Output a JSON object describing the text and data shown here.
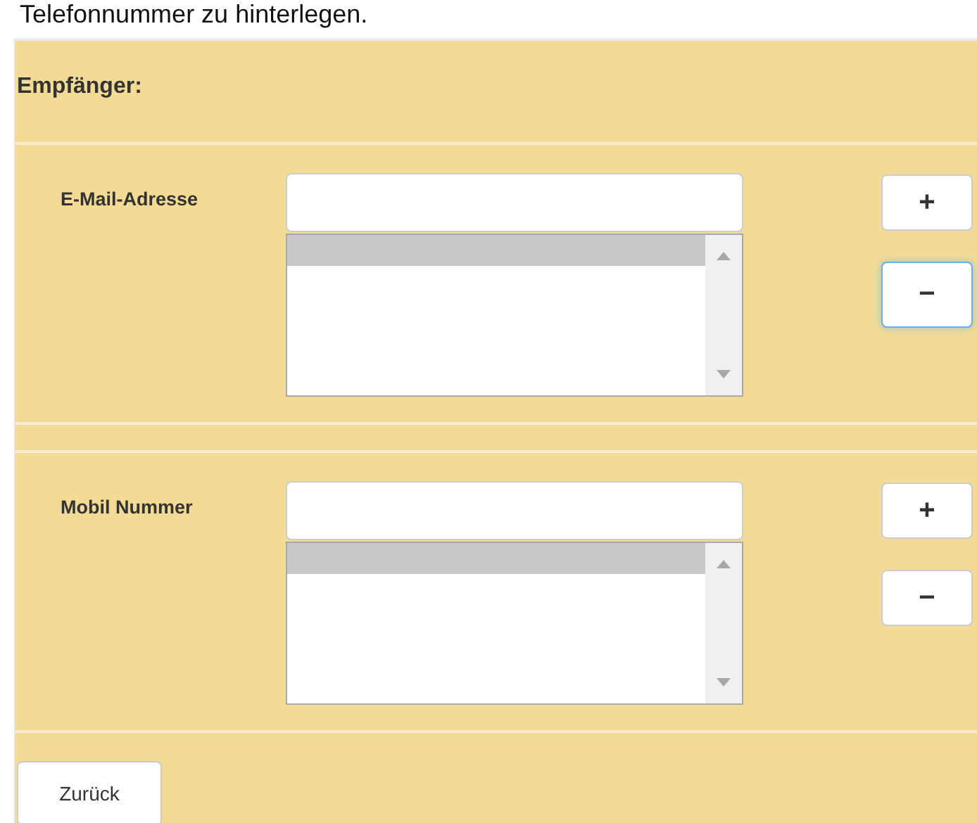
{
  "intro_text": "Telefonnummer zu hinterlegen.",
  "heading": "Empfänger:",
  "sections": [
    {
      "label": "E-Mail-Adresse",
      "list_entries": [
        {
          "selected": true
        }
      ],
      "buttons": [
        {
          "symbol": "+",
          "focused": false
        },
        {
          "symbol": "−",
          "focused": true
        }
      ]
    },
    {
      "label": "Mobil Nummer",
      "list_entries": [
        {
          "selected": true
        }
      ],
      "buttons": [
        {
          "symbol": "+",
          "focused": false
        },
        {
          "symbol": "−",
          "focused": false
        }
      ]
    }
  ],
  "back_button": "Zurück"
}
